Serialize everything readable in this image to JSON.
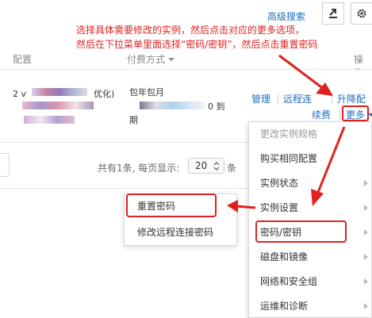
{
  "toolbar": {
    "advanced_search": "高级搜索",
    "export_icon": "export-icon",
    "settings_icon": "gear-icon"
  },
  "annotation": {
    "line1": "选择具体需要修改的实例，然后点击对应的更多选项，",
    "line2": "然后在下拉菜单里面选择“密码/密钥”，然后点击重置密码"
  },
  "table": {
    "headers": {
      "config": "配置",
      "pay": "付费方式",
      "ops": "操作"
    },
    "row": {
      "config_prefix": "2 v",
      "config_suffix": "优化)",
      "pay_type": "包年包月",
      "pay_until": "0 到",
      "pay_end": "期",
      "ops": {
        "manage": "管理",
        "remote": "远程连",
        "upgrade": "升降配",
        "renew": "续费",
        "more": "更多"
      }
    }
  },
  "pager": {
    "summary": "共有1条, 每页显示:",
    "page_size": "20",
    "unit": "条"
  },
  "menu": {
    "items": [
      {
        "label": "更改实例规格"
      },
      {
        "label": "购买相同配置"
      },
      {
        "label": "实例状态"
      },
      {
        "label": "实例设置"
      },
      {
        "label": "密码/密钥"
      },
      {
        "label": "磁盘和镜像"
      },
      {
        "label": "网络和安全组"
      },
      {
        "label": "运维和诊断"
      }
    ],
    "submenu": [
      {
        "label": "重置密码"
      },
      {
        "label": "修改远程连接密码"
      }
    ]
  },
  "colors": {
    "accent_red": "#e02020",
    "link_blue": "#1f6fbf"
  }
}
